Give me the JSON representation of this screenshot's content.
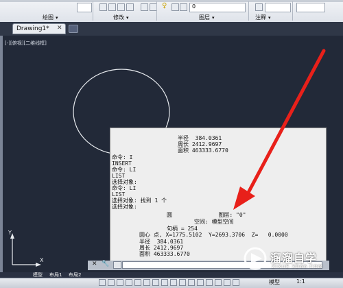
{
  "ribbon": {
    "groups": [
      {
        "label": "绘图"
      },
      {
        "label": "修改"
      },
      {
        "label": "图层"
      },
      {
        "label": "注释"
      }
    ],
    "layer_value": "0"
  },
  "tab": {
    "title": "Drawing1*",
    "close": "✕"
  },
  "viewport": {
    "label": "[-][俯视][二维线框]"
  },
  "text_window": {
    "lines_top": [
      "半径  384.0361",
      "周长 2412.9697",
      "面积 463333.6770"
    ],
    "lines_history": [
      "命令: I",
      "INSERT",
      "命令: LI",
      "LIST",
      "选择对象:",
      "命令: LI",
      "LIST",
      "选择对象: 找到 1 个",
      "选择对象:"
    ],
    "line_circle": "圆              图层: \"0\"",
    "line_space": "空间: 模型空间",
    "line_handle": "句柄 = 254",
    "line_center": "圆心 点, X=1775.5102  Y=2693.3706  Z=   0.0000",
    "lines_bottom": [
      "半径  384.0361",
      "周长 2412.9697",
      "面积 463333.6770"
    ]
  },
  "command": {
    "close_icon": "✕",
    "tool_icon": "🔧",
    "prompt_icon": "▶"
  },
  "layout_tabs": [
    "模型",
    "布局1",
    "布局2"
  ],
  "status": {
    "model": "模型",
    "scale": "1:1"
  },
  "watermark": {
    "brand": "溜溜自学",
    "site": "ZIXUE.3D66.COM"
  },
  "colors": {
    "arrow": "#e8201a",
    "canvas": "#222938"
  }
}
